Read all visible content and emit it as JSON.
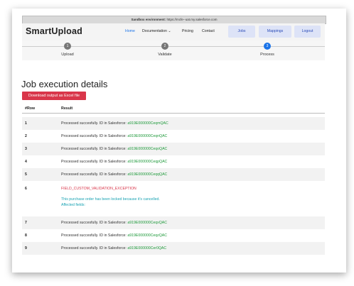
{
  "sandbox": {
    "label": "Sandbox environment:",
    "url": "https://mcfe--uat.my.salesforce.com"
  },
  "nav": {
    "brand": "SmartUpload",
    "links": [
      "Home",
      "Documentation",
      "Pricing",
      "Contact"
    ],
    "buttons": [
      "Jobs",
      "Mappings",
      "Logout"
    ]
  },
  "steps": [
    {
      "number": "1",
      "label": "Upload"
    },
    {
      "number": "2",
      "label": "Validate"
    },
    {
      "number": "3",
      "label": "Process"
    }
  ],
  "page_title": "Job execution details",
  "download_label": "Download output as Excel file",
  "table": {
    "headers": [
      "#Row",
      "Result"
    ],
    "result_prefix": "Processed succesfully. ID in Salesforce:",
    "rows": [
      {
        "num": "1",
        "id": "a919E000000CeqmQAC"
      },
      {
        "num": "2",
        "id": "a919E000000CeqnQAC"
      },
      {
        "num": "3",
        "id": "a919E000000CeqoQAC"
      },
      {
        "num": "4",
        "id": "a919E000000CeqpQAC"
      },
      {
        "num": "5",
        "id": "a919E000000CeqqQAC"
      },
      {
        "num": "6",
        "error_code": "FIELD_CUSTOM_VALIDATION_EXCEPTION",
        "error_message": "This purchase order has been locked because it's cancelled.",
        "error_fields": "Affected fields:"
      },
      {
        "num": "7",
        "id": "a919E000000CeqxQAC"
      },
      {
        "num": "8",
        "id": "a919E000000CeqzQAC"
      },
      {
        "num": "9",
        "id": "a919E000000Cer0QAC"
      }
    ]
  },
  "colors": {
    "primary": "#1a73e8",
    "danger": "#d9364a",
    "success": "#1f9a3b",
    "info": "#1aa3b3"
  }
}
